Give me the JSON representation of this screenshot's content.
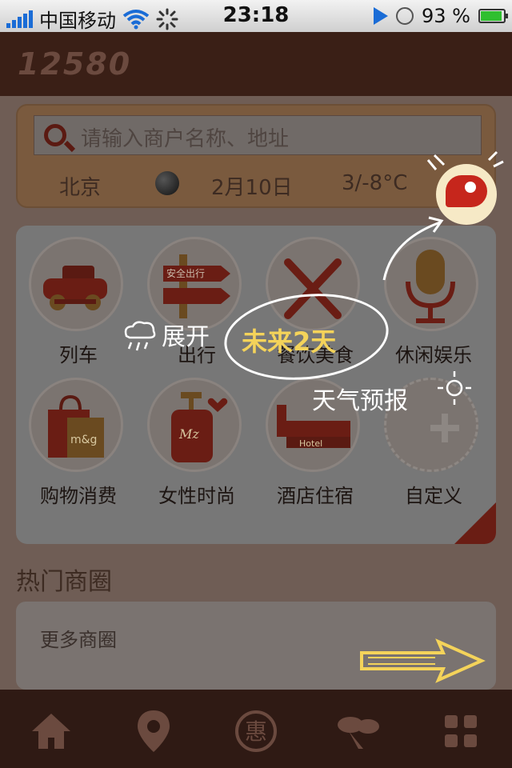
{
  "status_bar": {
    "carrier": "中国移动",
    "time": "23:18",
    "battery": "93 %"
  },
  "header": {
    "logo": "12580"
  },
  "search": {
    "placeholder": "请输入商户名称、地址",
    "city": "北京",
    "date": "2月10日",
    "temperature": "3/-8°C"
  },
  "categories": [
    {
      "label": "列车",
      "icon": "train-icon"
    },
    {
      "label": "出行",
      "icon": "signpost-icon",
      "sign_text": "安全出行"
    },
    {
      "label": "餐饮美食",
      "icon": "fork-knife-icon"
    },
    {
      "label": "休闲娱乐",
      "icon": "microphone-icon"
    },
    {
      "label": "购物消费",
      "icon": "shopping-bag-icon",
      "bag_text": "m&g"
    },
    {
      "label": "女性时尚",
      "icon": "cosmetic-bottle-icon",
      "bottle_text": "Mz"
    },
    {
      "label": "酒店住宿",
      "icon": "hotel-bed-icon",
      "bed_text": "Hotel"
    },
    {
      "label": "自定义",
      "icon": "add-icon"
    }
  ],
  "hot_areas": {
    "title": "热门商圈",
    "more_label": "更多商圈"
  },
  "tabs": [
    {
      "icon": "home-icon"
    },
    {
      "icon": "map-pin-icon"
    },
    {
      "icon": "discount-icon",
      "text": "惠"
    },
    {
      "icon": "social-icon"
    },
    {
      "icon": "grid-icon"
    }
  ],
  "overlay": {
    "expand_text": "展开",
    "future_days": "未来2天",
    "weather_forecast": "天气预报"
  },
  "colors": {
    "accent_red": "#c6261c",
    "brand_brown": "#3a1f16",
    "highlight_yellow": "#f4d35a"
  }
}
